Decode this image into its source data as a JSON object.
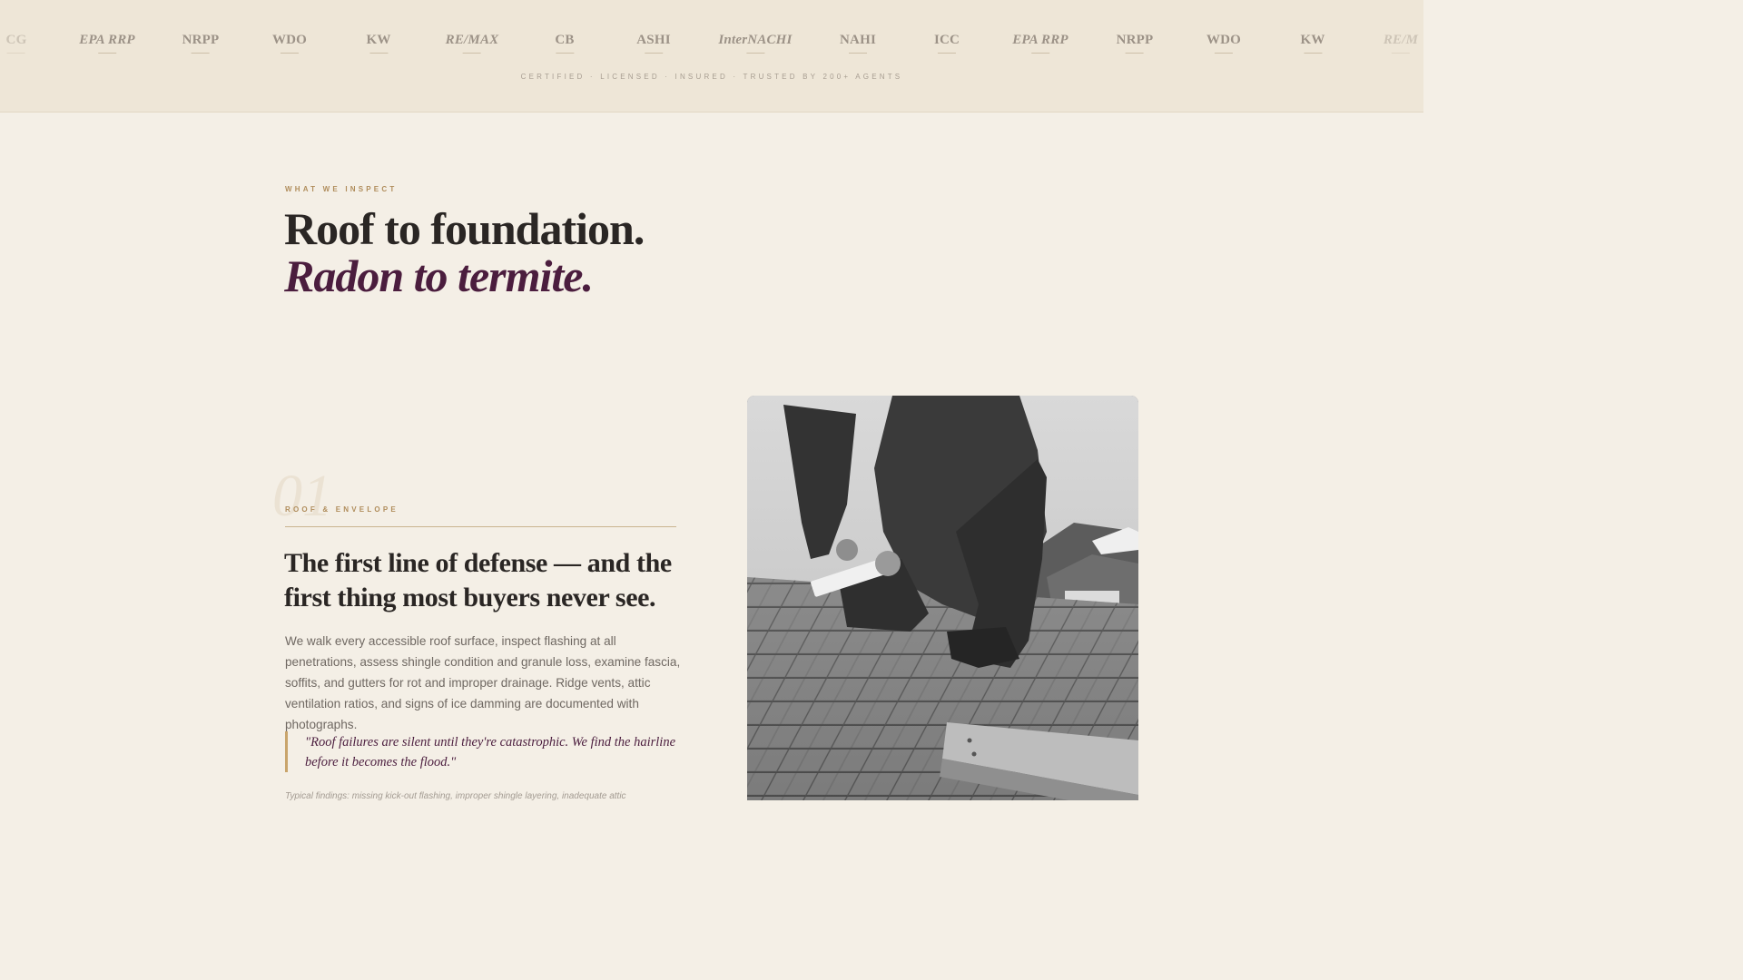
{
  "credentials": {
    "logos": [
      {
        "name": "CG",
        "italic": false,
        "faded": true
      },
      {
        "name": "EPA RRP",
        "italic": true,
        "faded": false
      },
      {
        "name": "NRPP",
        "italic": false,
        "faded": false
      },
      {
        "name": "WDO",
        "italic": false,
        "faded": false
      },
      {
        "name": "KW",
        "italic": false,
        "faded": false
      },
      {
        "name": "RE/MAX",
        "italic": true,
        "faded": false
      },
      {
        "name": "CB",
        "italic": false,
        "faded": false
      },
      {
        "name": "ASHI",
        "italic": false,
        "faded": false
      },
      {
        "name": "InterNACHI",
        "italic": true,
        "faded": false
      },
      {
        "name": "NAHI",
        "italic": false,
        "faded": false
      },
      {
        "name": "ICC",
        "italic": false,
        "faded": false
      },
      {
        "name": "EPA RRP",
        "italic": true,
        "faded": false
      },
      {
        "name": "NRPP",
        "italic": false,
        "faded": false
      },
      {
        "name": "WDO",
        "italic": false,
        "faded": false
      },
      {
        "name": "KW",
        "italic": false,
        "faded": false
      },
      {
        "name": "RE/M",
        "italic": true,
        "faded": true
      }
    ],
    "tagline": "CERTIFIED · LICENSED · INSURED · TRUSTED BY 200+ AGENTS"
  },
  "section": {
    "eyebrow": "WHAT WE INSPECT",
    "headline_line1": "Roof to foundation.",
    "headline_line2": "Radon to termite."
  },
  "item": {
    "number": "01",
    "tag": "ROOF & ENVELOPE",
    "title": "The first line of defense — and the first thing most buyers never see.",
    "body": "We walk every accessible roof surface, inspect flashing at all penetrations, assess shingle condition and granule loss, examine fascia, soffits, and gutters for rot and improper drainage. Ridge vents, attic ventilation ratios, and signs of ice damming are documented with photographs.",
    "quote": "\"Roof failures are silent until they're catastrophic. We find the hairline before it becomes the flood.\"",
    "findings": "Typical findings: missing kick-out flashing, improper shingle layering, inadequate attic"
  },
  "colors": {
    "background": "#f4efe6",
    "strip": "#eee6d7",
    "accent_gold": "#b08d5c",
    "accent_plum": "#4b1d3e",
    "text_dark": "#2a2624"
  }
}
